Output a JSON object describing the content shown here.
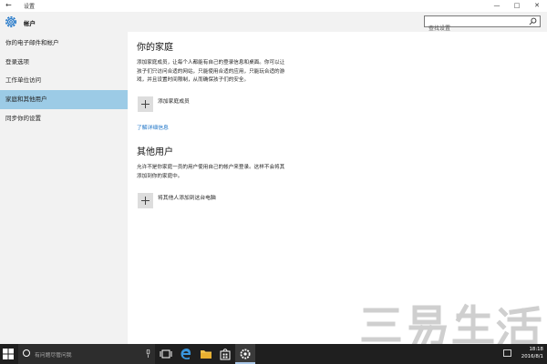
{
  "window": {
    "title": "设置",
    "back_glyph": "←",
    "controls": {
      "minimize": "—",
      "maximize": "□",
      "close": "✕"
    }
  },
  "header": {
    "app_title": "帐户",
    "search_placeholder": "查找设置",
    "icons": [
      "gear-icon",
      "search-icon"
    ]
  },
  "sidebar": {
    "items": [
      {
        "label": "你的电子邮件和帐户",
        "selected": false
      },
      {
        "label": "登录选项",
        "selected": false
      },
      {
        "label": "工作单位访问",
        "selected": false
      },
      {
        "label": "家庭和其他用户",
        "selected": true
      },
      {
        "label": "同步你的设置",
        "selected": false
      }
    ]
  },
  "main": {
    "family": {
      "heading": "你的家庭",
      "description_lines": [
        "添加家庭成员，让每个人都能有自己的登录信息和桌面。你可以让",
        "孩子们只访问合适的网站，只能使用合适的应用，只能玩合适的游",
        "戏，并且设置时间限制，从而确保孩子们的安全。"
      ],
      "add_label": "添加家庭成员",
      "learn_more": "了解详细信息"
    },
    "others": {
      "heading": "其他用户",
      "description_lines": [
        "允许不是你家庭一员的用户使用自己的帐户来登录。这样不会将其",
        "添加到你的家庭中。"
      ],
      "add_label": "将其他人添加到这台电脑"
    }
  },
  "watermark": {
    "text": "三易生活"
  },
  "taskbar": {
    "search_placeholder": "有问题尽管问我",
    "time": "18:18",
    "date": "2016/8/1",
    "accent_color": "#aac7e8"
  },
  "colors": {
    "selected_nav": "#9ccbe6",
    "link": "#1b73c7",
    "sidebar_bg": "#f2f2f2",
    "taskbar_bg": "#1f1f1f"
  }
}
